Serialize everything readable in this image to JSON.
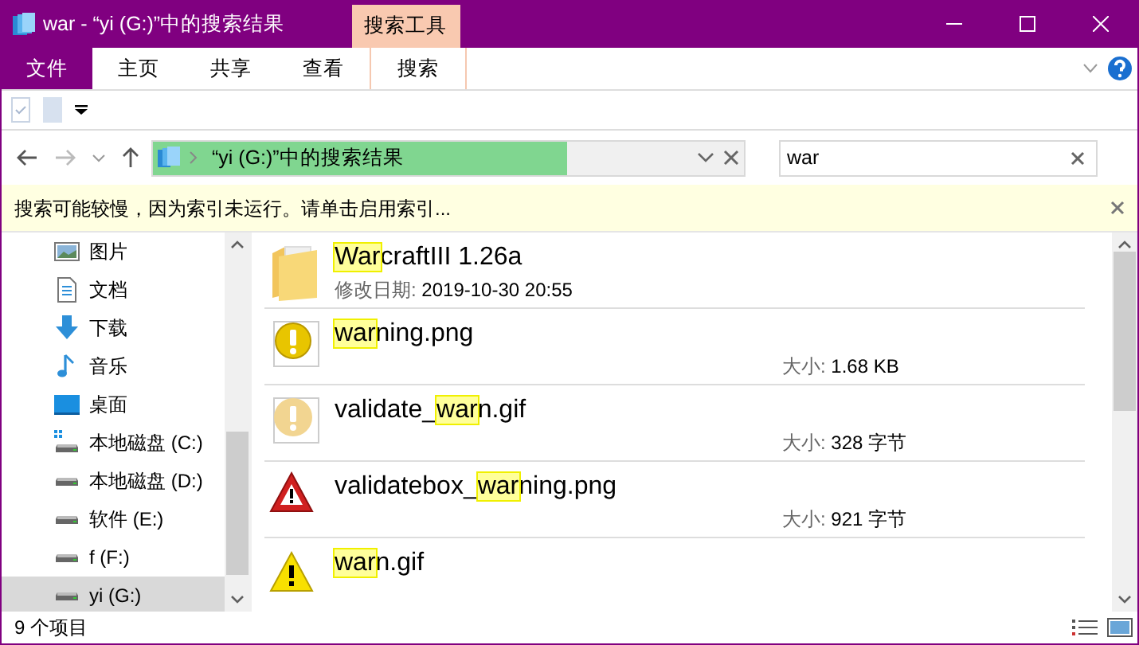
{
  "window": {
    "title": "war - “yi (G:)”中的搜索结果",
    "context_tab_group": "搜索工具"
  },
  "ribbon_tabs": [
    {
      "label": "文件",
      "kind": "file"
    },
    {
      "label": "主页",
      "kind": "normal"
    },
    {
      "label": "共享",
      "kind": "normal"
    },
    {
      "label": "查看",
      "kind": "normal"
    },
    {
      "label": "搜索",
      "kind": "contextual"
    }
  ],
  "address_bar": {
    "path": "“yi (G:)”中的搜索结果",
    "level": 0.7
  },
  "search": {
    "value": "war"
  },
  "info_bar": {
    "text": "搜索可能较慢，因为索引未运行。请单击启用索引..."
  },
  "sidebar": {
    "items": [
      {
        "label": "图片",
        "kind": "pictures",
        "selected": false
      },
      {
        "label": "文档",
        "kind": "documents",
        "selected": false
      },
      {
        "label": "下载",
        "kind": "downloads",
        "selected": false
      },
      {
        "label": "音乐",
        "kind": "music",
        "selected": false
      },
      {
        "label": "桌面",
        "kind": "desktop",
        "selected": false
      },
      {
        "label": "本地磁盘 (C:)",
        "kind": "system-drive",
        "selected": false
      },
      {
        "label": "本地磁盘 (D:)",
        "kind": "drive",
        "selected": false
      },
      {
        "label": "软件 (E:)",
        "kind": "drive",
        "selected": false
      },
      {
        "label": "f (F:)",
        "kind": "drive",
        "selected": false
      },
      {
        "label": "yi (G:)",
        "kind": "drive",
        "selected": true
      }
    ]
  },
  "results": [
    {
      "kind": "folder",
      "name": [
        {
          "text": "War",
          "highlighted": true
        },
        {
          "text": "craftIII 1.26a",
          "highlighted": false
        }
      ],
      "detail_label": "修改日期:",
      "detail_value": "2019-10-30 20:55"
    },
    {
      "kind": "round-warning",
      "name": [
        {
          "text": "war",
          "highlighted": true
        },
        {
          "text": "ning.png",
          "highlighted": false
        }
      ],
      "detail_label": "大小:",
      "detail_value": "1.68 KB"
    },
    {
      "kind": "faded-warning",
      "name": [
        {
          "text": "validate_",
          "highlighted": false
        },
        {
          "text": "war",
          "highlighted": true
        },
        {
          "text": "n.gif",
          "highlighted": false
        }
      ],
      "detail_label": "大小:",
      "detail_value": "328 字节"
    },
    {
      "kind": "red-triangle",
      "name": [
        {
          "text": "validatebox_",
          "highlighted": false
        },
        {
          "text": "war",
          "highlighted": true
        },
        {
          "text": "ning.png",
          "highlighted": false
        }
      ],
      "detail_label": "大小:",
      "detail_value": "921 字节"
    },
    {
      "kind": "yellow-triangle",
      "name": [
        {
          "text": "war",
          "highlighted": true
        },
        {
          "text": "n.gif",
          "highlighted": false
        }
      ]
    }
  ],
  "status_bar": {
    "item_count": "9 个项目"
  }
}
